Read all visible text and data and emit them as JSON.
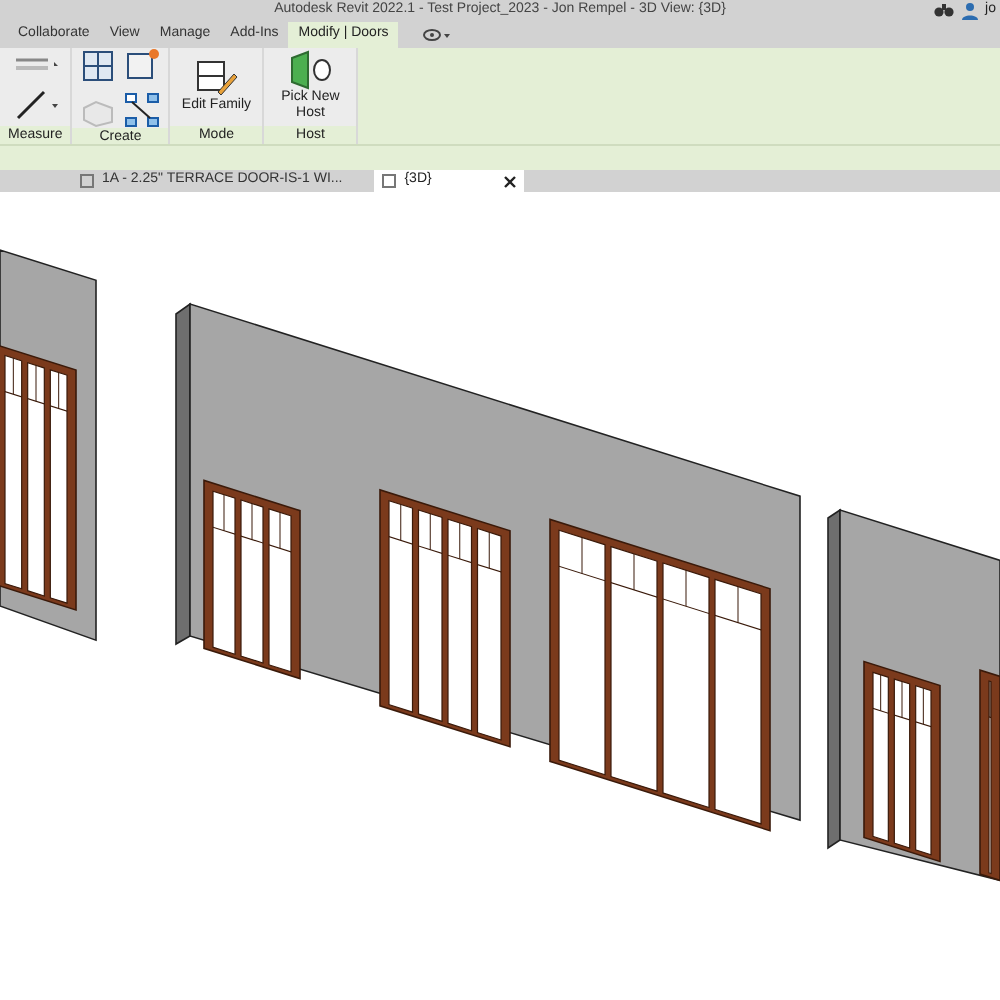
{
  "window": {
    "title": "Autodesk Revit 2022.1 - Test Project_2023 - Jon Rempel - 3D View: {3D}",
    "user_name": "jo"
  },
  "ribbon_tabs": [
    {
      "label": "Collaborate",
      "selected": false
    },
    {
      "label": "View",
      "selected": false
    },
    {
      "label": "Manage",
      "selected": false
    },
    {
      "label": "Add-Ins",
      "selected": false
    },
    {
      "label": "Modify | Doors",
      "selected": true
    }
  ],
  "ribbon_panels": [
    {
      "kind": "measure",
      "label": "Measure"
    },
    {
      "kind": "create",
      "label": "Create"
    },
    {
      "kind": "mode",
      "label": "Mode",
      "button": "Edit Family"
    },
    {
      "kind": "host",
      "label": "Host",
      "button": "Pick New Host"
    }
  ],
  "view_tabs": [
    {
      "label": "1A - 2.25\" TERRACE DOOR-IS-1 WI...",
      "selected": false
    },
    {
      "label": "{3D}",
      "selected": true
    }
  ]
}
